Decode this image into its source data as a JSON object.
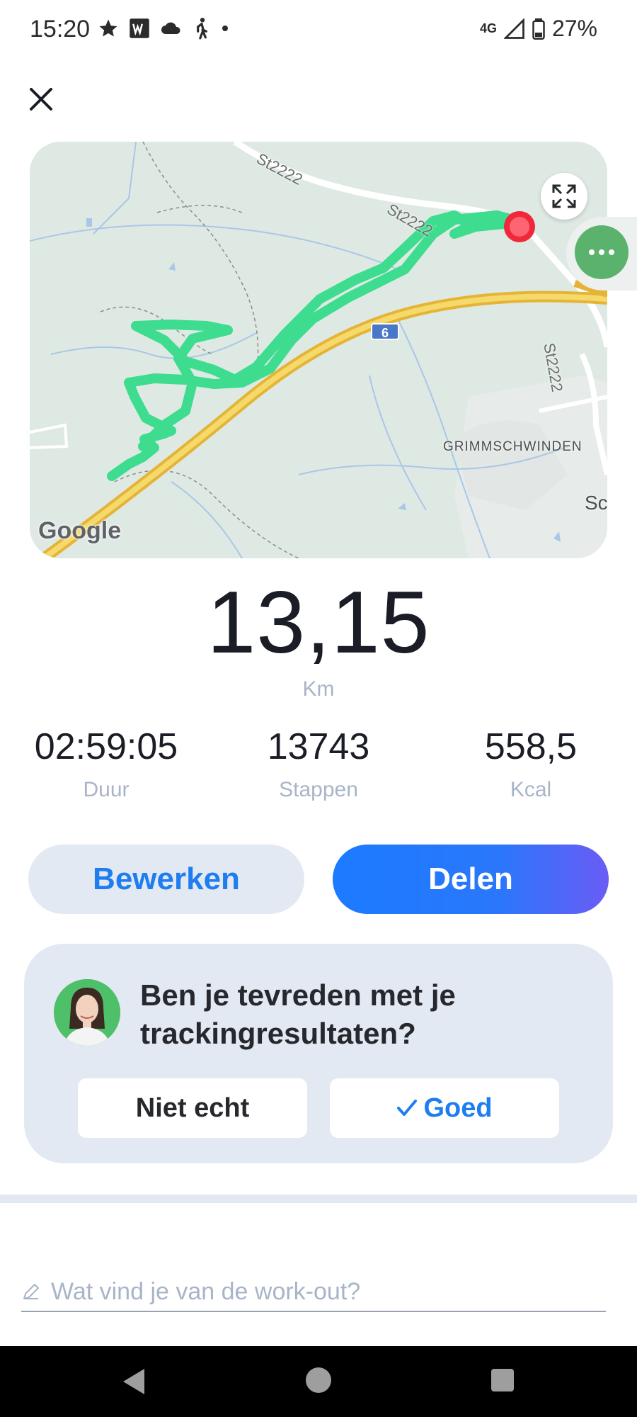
{
  "status_bar": {
    "time": "15:20",
    "network": "4G",
    "battery": "27%",
    "icons": [
      "star-icon",
      "w-app-icon",
      "cloud-icon",
      "walking-icon",
      "dot-icon",
      "signal-icon",
      "battery-icon"
    ]
  },
  "map": {
    "road_labels": [
      "St2222",
      "St2222",
      "St2222"
    ],
    "highway_shield": "6",
    "place_label": "GRIMMSCHWINDEN",
    "place_label_partial": "Sc",
    "attribution": "Google",
    "route_color": "#3ddc8f",
    "end_marker_color": "#f0283c"
  },
  "summary": {
    "distance": "13,15",
    "distance_unit": "Km",
    "stats": [
      {
        "value": "02:59:05",
        "label": "Duur"
      },
      {
        "value": "13743",
        "label": "Stappen"
      },
      {
        "value": "558,5",
        "label": "Kcal"
      }
    ]
  },
  "actions": {
    "edit_label": "Bewerken",
    "share_label": "Delen"
  },
  "feedback": {
    "question": "Ben je tevreden met je trackingresultaten?",
    "no_label": "Niet echt",
    "yes_label": "Goed"
  },
  "comment": {
    "placeholder": "Wat vind je van de work-out?"
  },
  "colors": {
    "accent": "#1e7df0",
    "card_bg": "#e3e9f2",
    "muted_text": "#a9b4c8"
  }
}
